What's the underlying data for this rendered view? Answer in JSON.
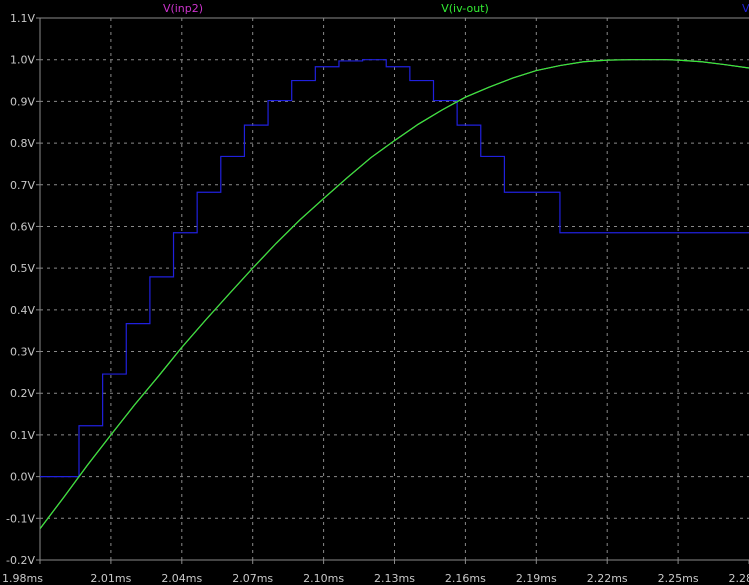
{
  "chart_data": {
    "type": "line",
    "xlim": [
      1.98,
      2.28
    ],
    "ylim": [
      -0.2,
      1.1
    ],
    "x_unit": "ms",
    "y_unit": "V",
    "grid": true,
    "x_ticks": [
      "1.98ms",
      "2.01ms",
      "2.04ms",
      "2.07ms",
      "2.10ms",
      "2.13ms",
      "2.16ms",
      "2.19ms",
      "2.22ms",
      "2.25ms",
      "2.28ms"
    ],
    "y_ticks": [
      "1.1V",
      "1.0V",
      "0.9V",
      "0.8V",
      "0.7V",
      "0.6V",
      "0.5V",
      "0.4V",
      "0.3V",
      "0.2V",
      "0.1V",
      "0.0V",
      "-0.1V",
      "-0.2V"
    ],
    "colors": {
      "background": "#000000",
      "grid": "#8a8a8a",
      "axis_text": "#c8c8c8",
      "inp2": "#cc33cc",
      "iv_out": "#33ee33",
      "dac": "#2020dd"
    },
    "series": [
      {
        "name": "V(inp2)",
        "color": "#cc33cc",
        "style": "smooth",
        "x": [
          1.98,
          1.99,
          2.0,
          2.01,
          2.02,
          2.03,
          2.04,
          2.05,
          2.06,
          2.07,
          2.08,
          2.09,
          2.1,
          2.11,
          2.12,
          2.13,
          2.14,
          2.15,
          2.16,
          2.17,
          2.18,
          2.19,
          2.2,
          2.21,
          2.22,
          2.23,
          2.24,
          2.245,
          2.25,
          2.26,
          2.27,
          2.28
        ],
        "y": [
          -0.125,
          -0.05,
          0.027,
          0.1,
          0.172,
          0.24,
          0.31,
          0.375,
          0.438,
          0.5,
          0.56,
          0.616,
          0.667,
          0.717,
          0.765,
          0.806,
          0.845,
          0.879,
          0.91,
          0.934,
          0.956,
          0.974,
          0.986,
          0.995,
          0.999,
          1.0,
          1.0,
          1.0,
          0.999,
          0.995,
          0.988,
          0.98
        ]
      },
      {
        "name": "V(iv-out)",
        "color": "#33ee33",
        "style": "smooth",
        "x": [
          1.98,
          1.99,
          2.0,
          2.01,
          2.02,
          2.03,
          2.04,
          2.05,
          2.06,
          2.07,
          2.08,
          2.09,
          2.1,
          2.11,
          2.12,
          2.13,
          2.14,
          2.15,
          2.16,
          2.17,
          2.18,
          2.19,
          2.2,
          2.21,
          2.22,
          2.23,
          2.24,
          2.245,
          2.25,
          2.26,
          2.27,
          2.28
        ],
        "y": [
          -0.125,
          -0.05,
          0.027,
          0.1,
          0.172,
          0.24,
          0.31,
          0.375,
          0.438,
          0.5,
          0.56,
          0.616,
          0.667,
          0.717,
          0.765,
          0.806,
          0.845,
          0.879,
          0.91,
          0.934,
          0.956,
          0.974,
          0.986,
          0.995,
          0.999,
          1.0,
          1.0,
          1.0,
          0.999,
          0.995,
          0.988,
          0.98
        ]
      },
      {
        "name": "V(dac)",
        "color": "#2020dd",
        "style": "step",
        "x": [
          1.98,
          1.9965,
          2.0065,
          2.0165,
          2.0265,
          2.0365,
          2.0465,
          2.0565,
          2.0665,
          2.0765,
          2.0865,
          2.0965,
          2.1065,
          2.1165,
          2.1265,
          2.1365,
          2.1465,
          2.1565,
          2.1665,
          2.1765,
          2.2,
          2.28
        ],
        "y": [
          0.0,
          0.122,
          0.246,
          0.367,
          0.479,
          0.585,
          0.682,
          0.768,
          0.843,
          0.902,
          0.95,
          0.983,
          0.997,
          1.0,
          0.983,
          0.95,
          0.902,
          0.843,
          0.768,
          0.682,
          0.585,
          0.585
        ]
      }
    ]
  }
}
